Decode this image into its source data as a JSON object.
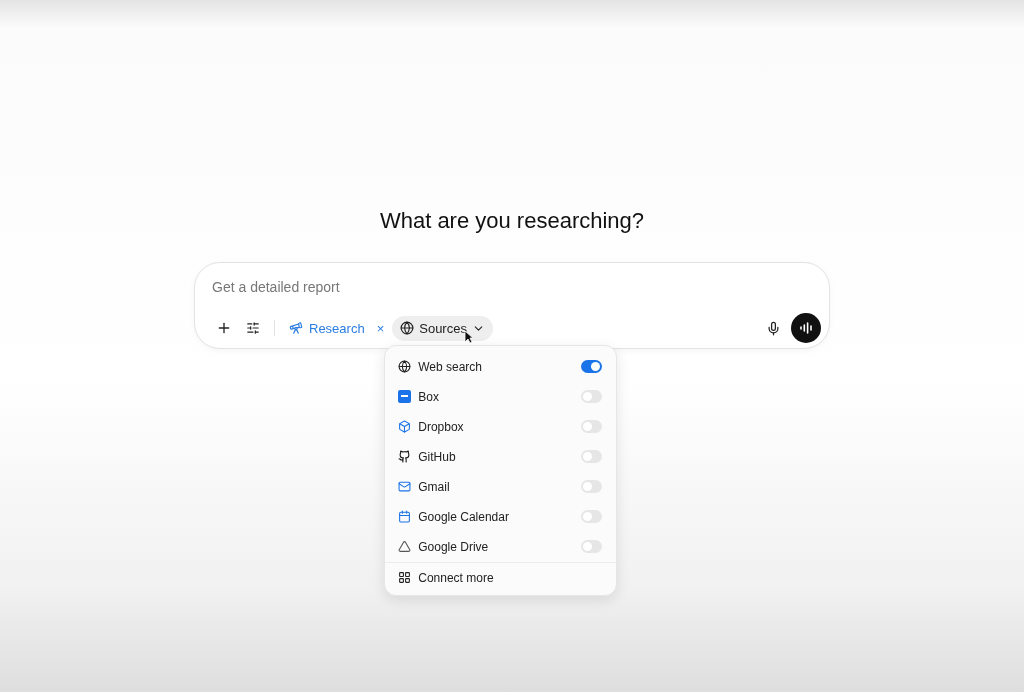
{
  "heading": "What are you researching?",
  "composer": {
    "placeholder": "Get a detailed report",
    "mode": {
      "label": "Research",
      "remove": "×"
    },
    "sources_button": {
      "label": "Sources",
      "expanded": true
    }
  },
  "sources": [
    {
      "kind": "globe",
      "label": "Web search",
      "on": true
    },
    {
      "kind": "box",
      "label": "Box",
      "on": false
    },
    {
      "kind": "dropbox",
      "label": "Dropbox",
      "on": false
    },
    {
      "kind": "github",
      "label": "GitHub",
      "on": false
    },
    {
      "kind": "gmail",
      "label": "Gmail",
      "on": false
    },
    {
      "kind": "calendar",
      "label": "Google Calendar",
      "on": false
    },
    {
      "kind": "drive",
      "label": "Google Drive",
      "on": false
    }
  ],
  "connect_more": "Connect more"
}
